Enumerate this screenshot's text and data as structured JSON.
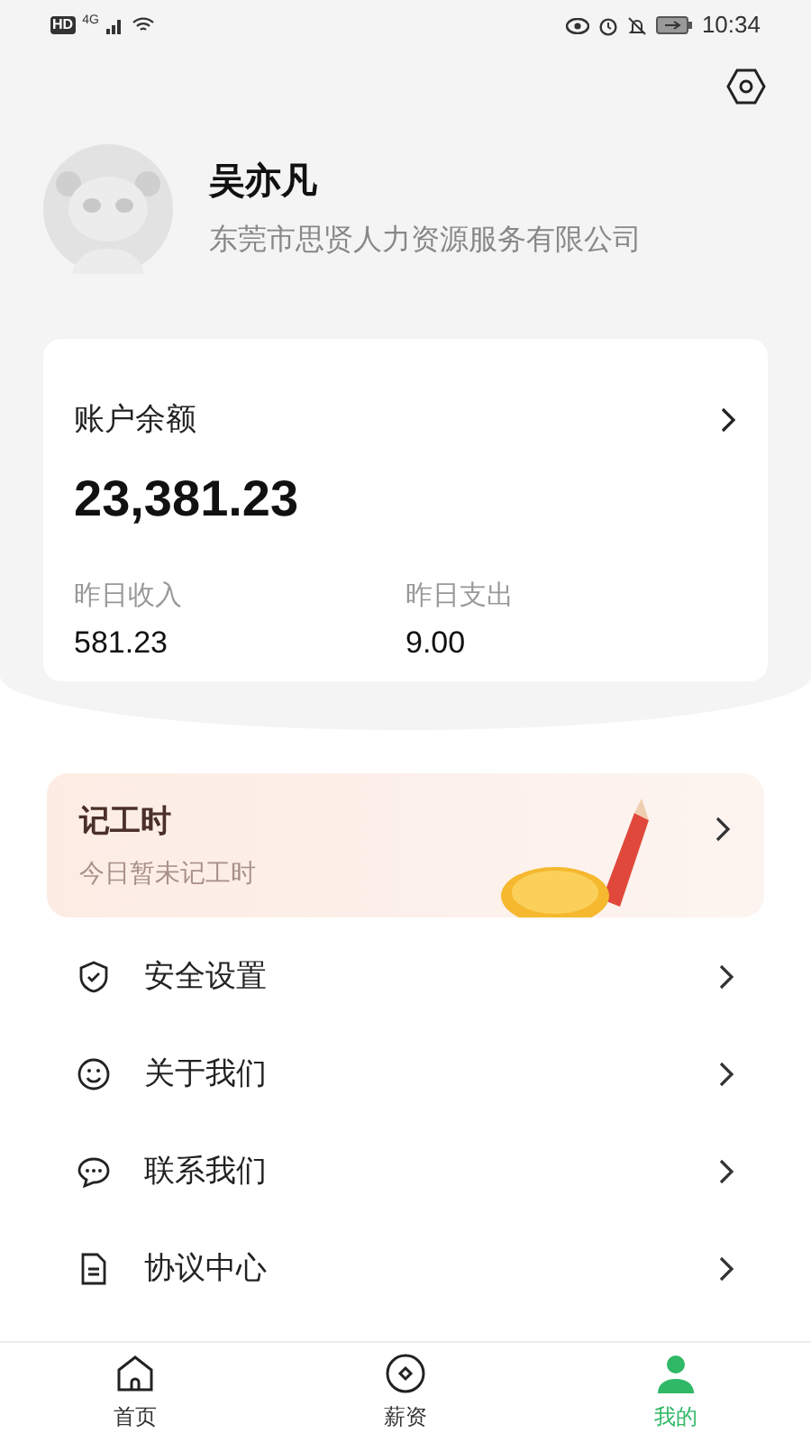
{
  "status_bar": {
    "badges": [
      "HD",
      "4G"
    ],
    "time": "10:34"
  },
  "profile": {
    "name": "吴亦凡",
    "company": "东莞市思贤人力资源服务有限公司"
  },
  "balance": {
    "title": "账户余额",
    "amount": "23,381.23",
    "stats": [
      {
        "label": "昨日收入",
        "value": "581.23"
      },
      {
        "label": "昨日支出",
        "value": "9.00"
      }
    ]
  },
  "work_hours": {
    "title": "记工时",
    "subtitle": "今日暂未记工时"
  },
  "menu": [
    {
      "kind": "shield",
      "label": "安全设置"
    },
    {
      "kind": "smile",
      "label": "关于我们"
    },
    {
      "kind": "chat",
      "label": "联系我们"
    },
    {
      "kind": "document",
      "label": "协议中心"
    }
  ],
  "tab_bar": [
    {
      "kind": "home",
      "label": "首页",
      "selected": false
    },
    {
      "kind": "salary",
      "label": "薪资",
      "selected": false
    },
    {
      "kind": "person",
      "label": "我的",
      "selected": true
    }
  ]
}
